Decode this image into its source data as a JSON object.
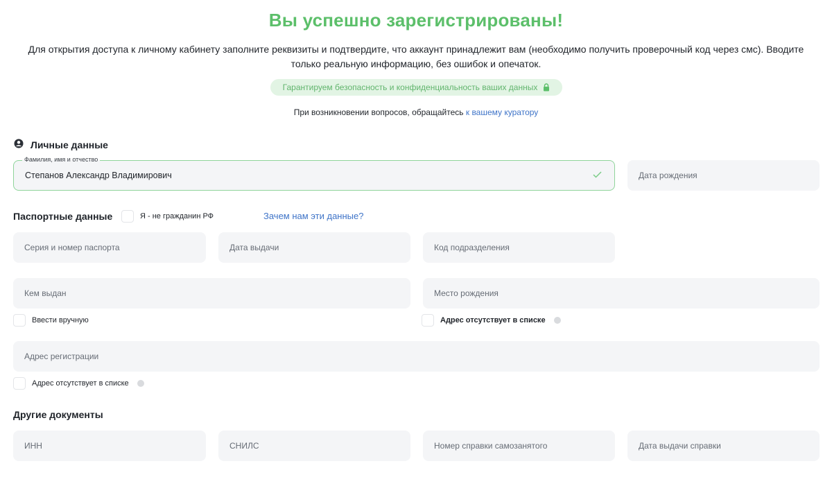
{
  "header": {
    "title": "Вы успешно зарегистрированы!",
    "intro": "Для открытия доступа к личному кабинету заполните реквизиты и подтвердите, что аккаунт принадлежит вам (необходимо получить проверочный код через смс). Вводите только реальную информацию, без ошибок и опечаток.",
    "guarantee": "Гарантируем безопасность и конфиденциальность ваших данных",
    "help_text": "При возникновении вопросов, обращайтесь",
    "help_link": "к вашему куратору"
  },
  "personal": {
    "heading": "Личные данные",
    "heading_icon": "user-circle-icon",
    "full_name": {
      "label": "Фамилия, имя и отчество",
      "value": "Степанов Александр Владимирович"
    },
    "birth_date": {
      "placeholder": "Дата рождения"
    }
  },
  "passport": {
    "heading": "Паспортные данные",
    "not_citizen_label": "Я - не гражданин РФ",
    "why_link": "Зачем нам эти данные?",
    "series_number": "Серия и номер паспорта",
    "issue_date": "Дата выдачи",
    "division_code": "Код подразделения",
    "issued_by": "Кем выдан",
    "birth_place": "Место рождения",
    "manual_entry_label": "Ввести вручную",
    "birth_place_missing_label": "Адрес отсутствует в списке",
    "registration_address": "Адрес регистрации",
    "registration_missing_label": "Адрес отсутствует в списке"
  },
  "other_documents": {
    "heading": "Другие документы",
    "inn": "ИНН",
    "snils": "СНИЛС",
    "self_employed_cert": "Номер справки самозанятого",
    "cert_issue_date": "Дата выдачи справки"
  },
  "colors": {
    "title_green": "#5cbf6a",
    "guarantee_bg": "#e2f4e4",
    "link_blue": "#3f74c8",
    "field_bg": "#f4f5f7",
    "valid_border": "#8fd49a"
  }
}
